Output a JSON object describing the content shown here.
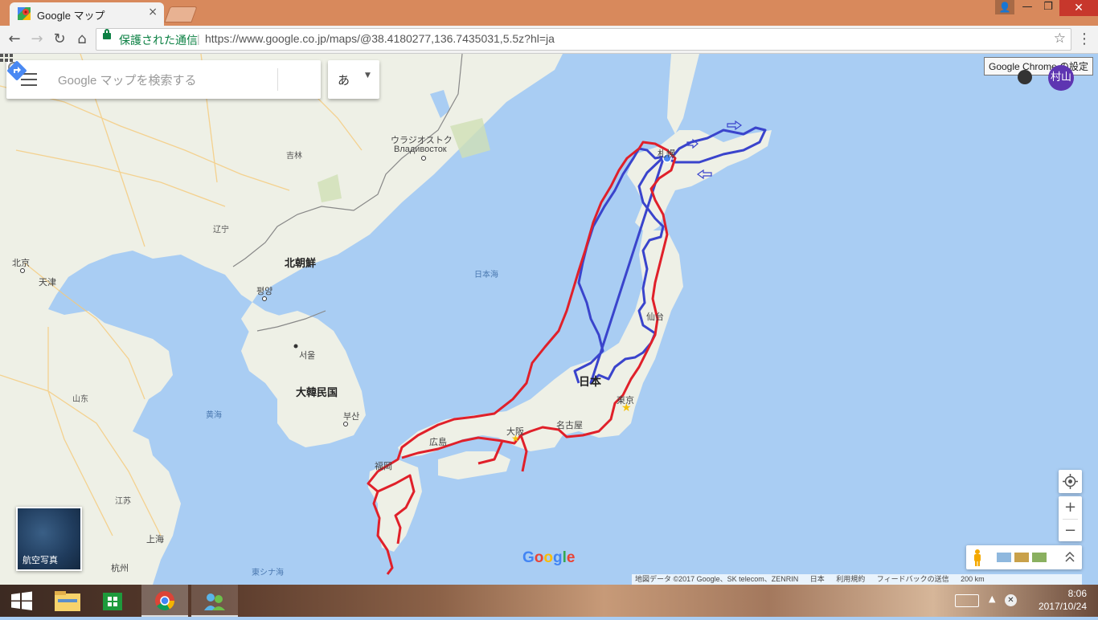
{
  "browser": {
    "tab_title": "Google マップ",
    "tab_close": "×",
    "secure_label": "保護された通信",
    "url": "https://www.google.co.jp/maps/@38.4180277,136.7435031,5.5z?hl=ja",
    "settings_tooltip": "Google Chrome の設定"
  },
  "maps": {
    "search_placeholder": "Google マップを検索する",
    "ime_char": "あ",
    "avatar_text": "村山",
    "satellite_label": "航空写真",
    "google_logo": "Google",
    "attribution": {
      "data": "地図データ ©2017 Google、SK telecom、ZENRIN",
      "country": "日本",
      "terms": "利用規約",
      "feedback": "フィードバックの送信",
      "scale": "200 km"
    },
    "labels": {
      "vladivostok_ja": "ウラジオストク",
      "vladivostok_ru": "Владивосток",
      "jilin": "吉林",
      "liaoning": "辽宁",
      "beijing": "北京",
      "tianjin": "天津",
      "north_korea": "北朝鮮",
      "pyongyang": "평양",
      "seoul": "서울",
      "south_korea": "大韓民国",
      "busan": "부산",
      "yellow_sea": "黄海",
      "sea_of_japan": "日本海",
      "japan": "日本",
      "sapporo": "札幌",
      "sendai": "仙台",
      "tokyo": "東京",
      "nagoya": "名古屋",
      "osaka": "大阪",
      "hiroshima": "広島",
      "fukuoka": "福岡",
      "shandong": "山东",
      "jiangsu": "江苏",
      "shanghai": "上海",
      "hangzhou": "杭州",
      "east_china_sea": "東シナ海"
    }
  },
  "taskbar": {
    "time": "8:06",
    "date": "2017/10/24"
  },
  "colors": {
    "route_red": "#e0202a",
    "route_blue": "#3a44cc",
    "sea": "#a9cdf3",
    "land": "#eef0e6",
    "titlebar": "#d8895c"
  }
}
